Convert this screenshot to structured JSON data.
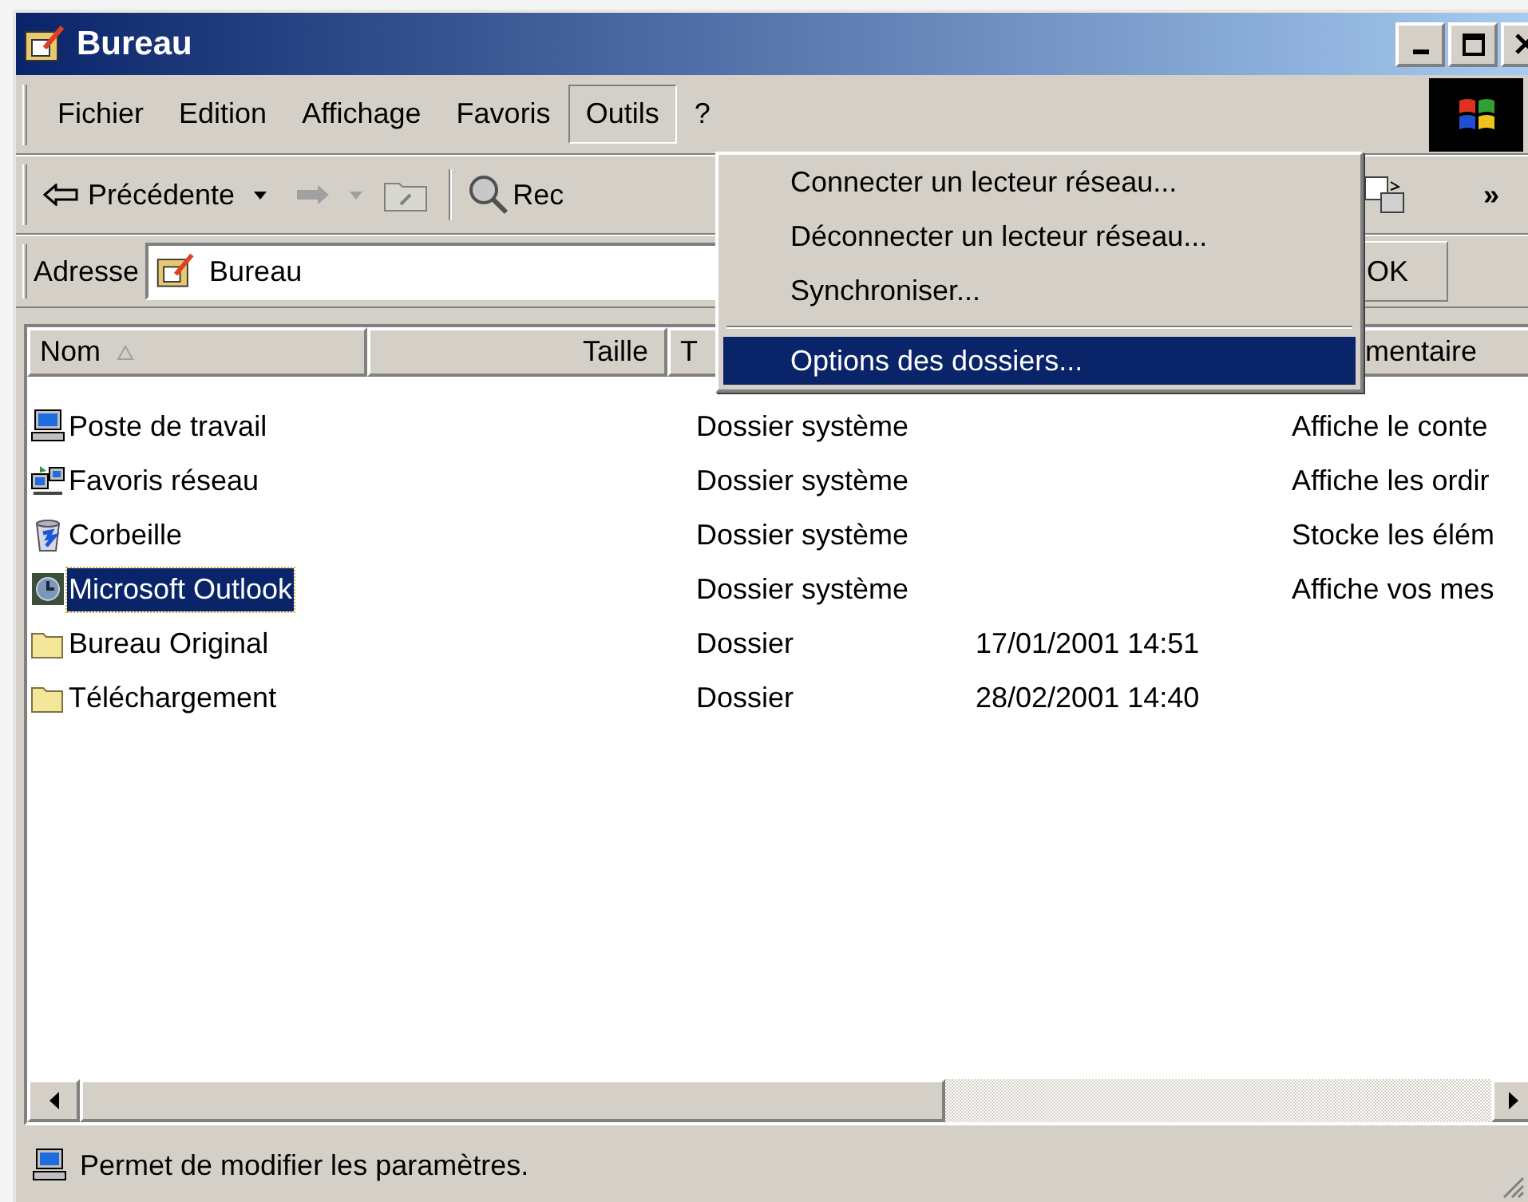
{
  "window": {
    "title": "Bureau"
  },
  "menu_bar": [
    {
      "label": "Fichier",
      "selected": false
    },
    {
      "label": "Edition",
      "selected": false
    },
    {
      "label": "Affichage",
      "selected": false
    },
    {
      "label": "Favoris",
      "selected": false
    },
    {
      "label": "Outils",
      "selected": true
    },
    {
      "label": "?",
      "selected": false
    }
  ],
  "toolbar": {
    "back": "Précédente",
    "search": "Rec",
    "overflow": "»"
  },
  "address": {
    "label": "Adresse",
    "value": "Bureau",
    "go": "OK"
  },
  "columns": [
    {
      "label": "Nom",
      "sorted": true
    },
    {
      "label": "Taille",
      "sorted": false
    },
    {
      "label": "T",
      "sorted": false
    },
    {
      "label": "mentaire",
      "sorted": false
    }
  ],
  "rows": [
    {
      "name": "Poste de travail",
      "kind": "computer",
      "type": "Dossier système",
      "comment": "Affiche le conte",
      "selected": false
    },
    {
      "name": "Favoris réseau",
      "kind": "network",
      "type": "Dossier système",
      "comment": "Affiche les ordir",
      "selected": false
    },
    {
      "name": "Corbeille",
      "kind": "recycle",
      "type": "Dossier système",
      "comment": "Stocke les élém",
      "selected": false
    },
    {
      "name": "Microsoft Outlook",
      "kind": "outlook",
      "type": "Dossier système",
      "comment": "Affiche vos mes",
      "selected": true
    },
    {
      "name": "Bureau Original",
      "kind": "folder",
      "type": "Dossier",
      "date": "17/01/2001 14:51",
      "selected": false
    },
    {
      "name": "Téléchargement",
      "kind": "folder",
      "type": "Dossier",
      "date": "28/02/2001 14:40",
      "selected": false
    }
  ],
  "dropdown": [
    {
      "kind": "item",
      "label": "Connecter un lecteur réseau...",
      "selected": false
    },
    {
      "kind": "item",
      "label": "Déconnecter un lecteur réseau...",
      "selected": false
    },
    {
      "kind": "item",
      "label": "Synchroniser...",
      "selected": false
    },
    {
      "kind": "separator"
    },
    {
      "kind": "item",
      "label": "Options des dossiers...",
      "selected": true
    }
  ],
  "status_bar": {
    "text": "Permet de modifier les paramètres."
  }
}
